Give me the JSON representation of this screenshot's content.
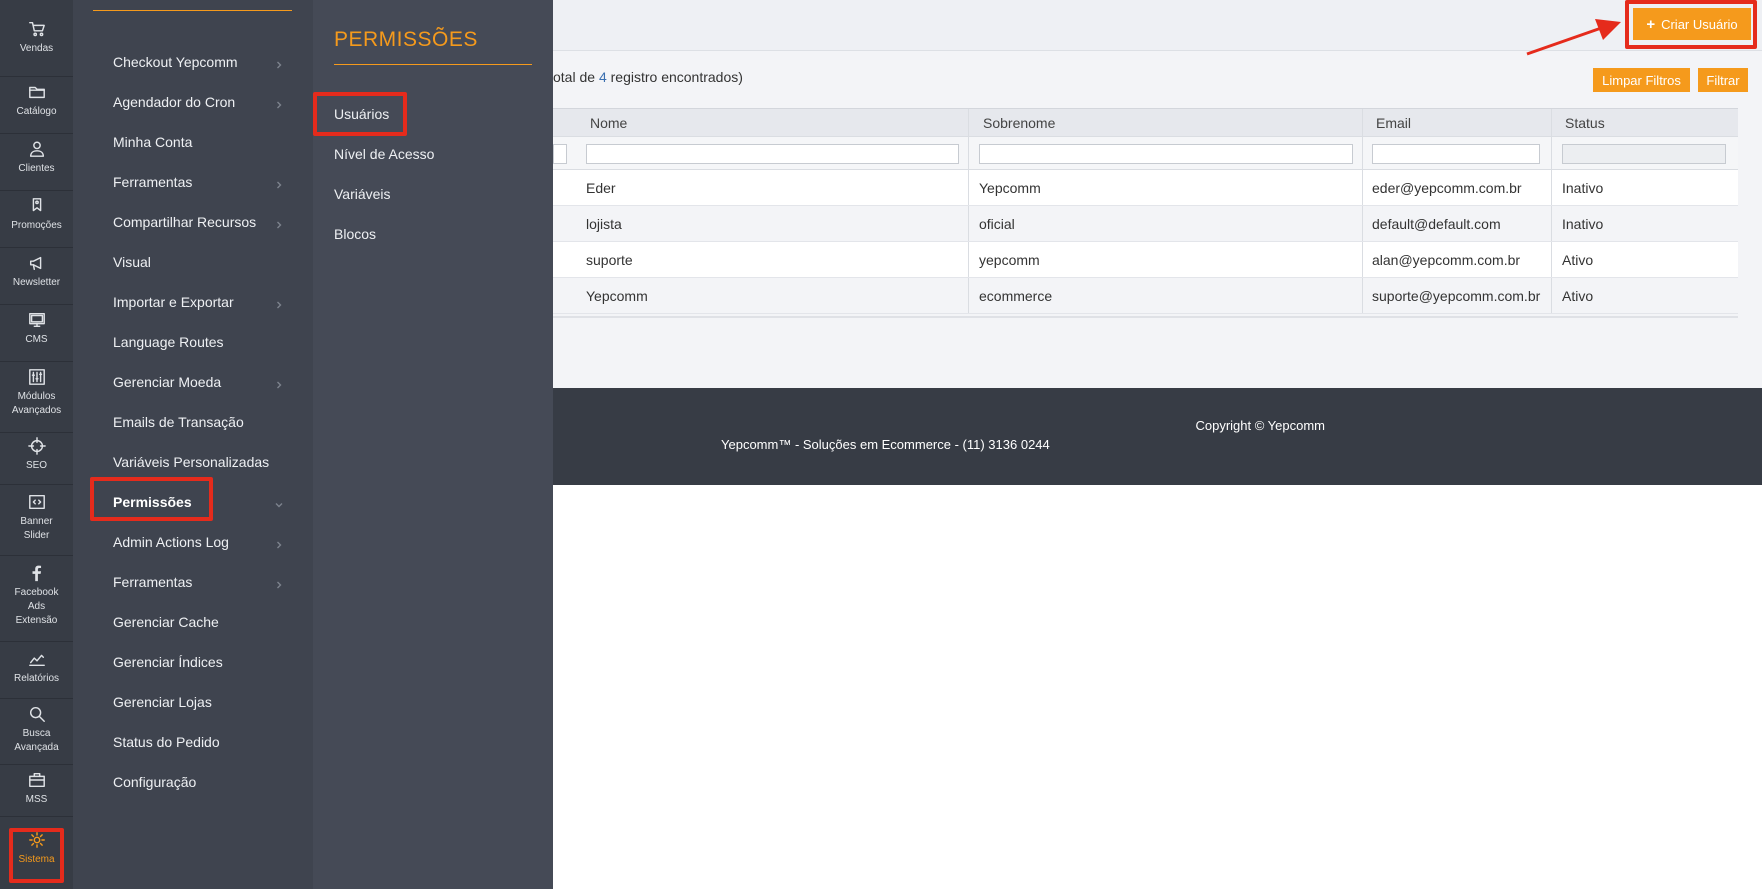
{
  "rail": {
    "items": [
      {
        "label": "Vendas",
        "icon": "cart-icon"
      },
      {
        "label": "Catálogo",
        "icon": "folder-icon"
      },
      {
        "label": "Clientes",
        "icon": "user-icon"
      },
      {
        "label": "Promoções",
        "icon": "tag-icon"
      },
      {
        "label": "Newsletter",
        "icon": "megaphone-icon"
      },
      {
        "label": "CMS",
        "icon": "monitor-icon"
      },
      {
        "label": "Módulos Avançados",
        "icon": "sliders-icon"
      },
      {
        "label": "SEO",
        "icon": "crosshair-icon"
      },
      {
        "label": "Banner Slider",
        "icon": "code-box-icon"
      },
      {
        "label": "Facebook Ads Extensão",
        "icon": "facebook-icon"
      },
      {
        "label": "Relatórios",
        "icon": "trend-chart-icon"
      },
      {
        "label": "Busca Avançada",
        "icon": "search-icon"
      },
      {
        "label": "MSS",
        "icon": "briefcase-icon"
      },
      {
        "label": "Sistema",
        "icon": "gear-icon"
      }
    ],
    "active_label": "Sistema"
  },
  "menu2": {
    "items": [
      {
        "label": "Checkout Yepcomm",
        "chevron": "right"
      },
      {
        "label": "Agendador do Cron",
        "chevron": "right"
      },
      {
        "label": "Minha Conta",
        "chevron": ""
      },
      {
        "label": "Ferramentas",
        "chevron": "right"
      },
      {
        "label": "Compartilhar Recursos",
        "chevron": "right"
      },
      {
        "label": "Visual",
        "chevron": ""
      },
      {
        "label": "Importar e Exportar",
        "chevron": "right"
      },
      {
        "label": "Language Routes",
        "chevron": ""
      },
      {
        "label": "Gerenciar Moeda",
        "chevron": "right"
      },
      {
        "label": "Emails de Transação",
        "chevron": ""
      },
      {
        "label": "Variáveis Personalizadas",
        "chevron": ""
      },
      {
        "label": "Permissões",
        "chevron": "down"
      },
      {
        "label": "Admin Actions Log",
        "chevron": "right"
      },
      {
        "label": "Ferramentas",
        "chevron": "right"
      },
      {
        "label": "Gerenciar Cache",
        "chevron": ""
      },
      {
        "label": "Gerenciar Índices",
        "chevron": ""
      },
      {
        "label": "Gerenciar Lojas",
        "chevron": ""
      },
      {
        "label": "Status do Pedido",
        "chevron": ""
      },
      {
        "label": "Configuração",
        "chevron": ""
      }
    ]
  },
  "menu3": {
    "title": "PERMISSÕES",
    "items": [
      "Usuários",
      "Nível de Acesso",
      "Variáveis",
      "Blocos"
    ]
  },
  "main": {
    "create_button": "Criar Usuário",
    "records_prefix": "otal de ",
    "records_count": "4",
    "records_suffix": " registro encontrados)",
    "clear_filters": "Limpar Filtros",
    "filter": "Filtrar",
    "columns": [
      "Nome",
      "Sobrenome",
      "Email",
      "Status"
    ],
    "rows": [
      {
        "nome": "Eder",
        "sobrenome": "Yepcomm",
        "email": "eder@yepcomm.com.br",
        "status": "Inativo"
      },
      {
        "nome": "lojista",
        "sobrenome": "oficial",
        "email": "default@default.com",
        "status": "Inativo"
      },
      {
        "nome": "suporte",
        "sobrenome": "yepcomm",
        "email": "alan@yepcomm.com.br",
        "status": "Ativo"
      },
      {
        "nome": "Yepcomm",
        "sobrenome": "ecommerce",
        "email": "suporte@yepcomm.com.br",
        "status": "Ativo"
      }
    ]
  },
  "footer": {
    "line1": "Copyright © Yepcomm",
    "line2": "Yepcomm™ - Soluções em Ecommerce - (11) 3136 0244"
  },
  "colors": {
    "accent": "#f59a1c",
    "highlight": "#e52b1c",
    "rail_bg": "#373c45",
    "menu2_bg": "#3f444f",
    "menu3_bg": "#454a56"
  }
}
